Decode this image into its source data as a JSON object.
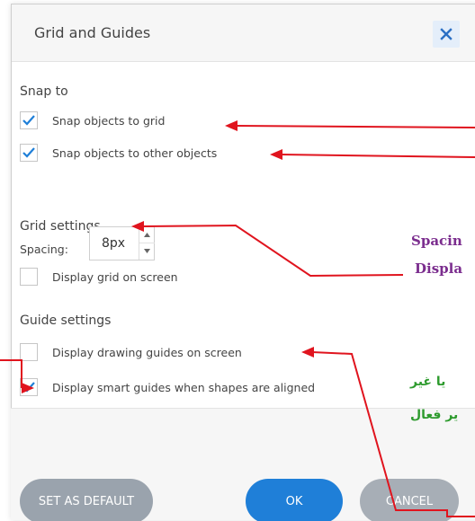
{
  "dialog": {
    "title": "Grid and Guides",
    "close_icon": "close-icon"
  },
  "snap": {
    "title": "Snap to",
    "items": [
      {
        "label": "Snap objects to grid",
        "checked": true
      },
      {
        "label": "Snap objects to other objects",
        "checked": true
      }
    ]
  },
  "grid": {
    "title": "Grid settings",
    "spacing_label": "Spacing:",
    "spacing_value": "8px",
    "display_label": "Display grid on screen",
    "display_checked": false
  },
  "guides": {
    "title": "Guide settings",
    "items": [
      {
        "label": "Display drawing guides on screen",
        "checked": false
      },
      {
        "label": "Display smart guides when shapes are aligned",
        "checked": true
      }
    ]
  },
  "footer": {
    "set_default": "SET AS DEFAULT",
    "ok": "OK",
    "cancel": "CANCEL"
  },
  "annotations": {
    "spacing": "Spacin",
    "display": "Displa",
    "arabic_line1": "یا غیر",
    "arabic_line2": "یر فعال"
  },
  "colors": {
    "accent": "#1f7fd8",
    "arrow": "#e0141e",
    "annot_purple": "#7b2d8e",
    "annot_green": "#2e9b2e"
  }
}
